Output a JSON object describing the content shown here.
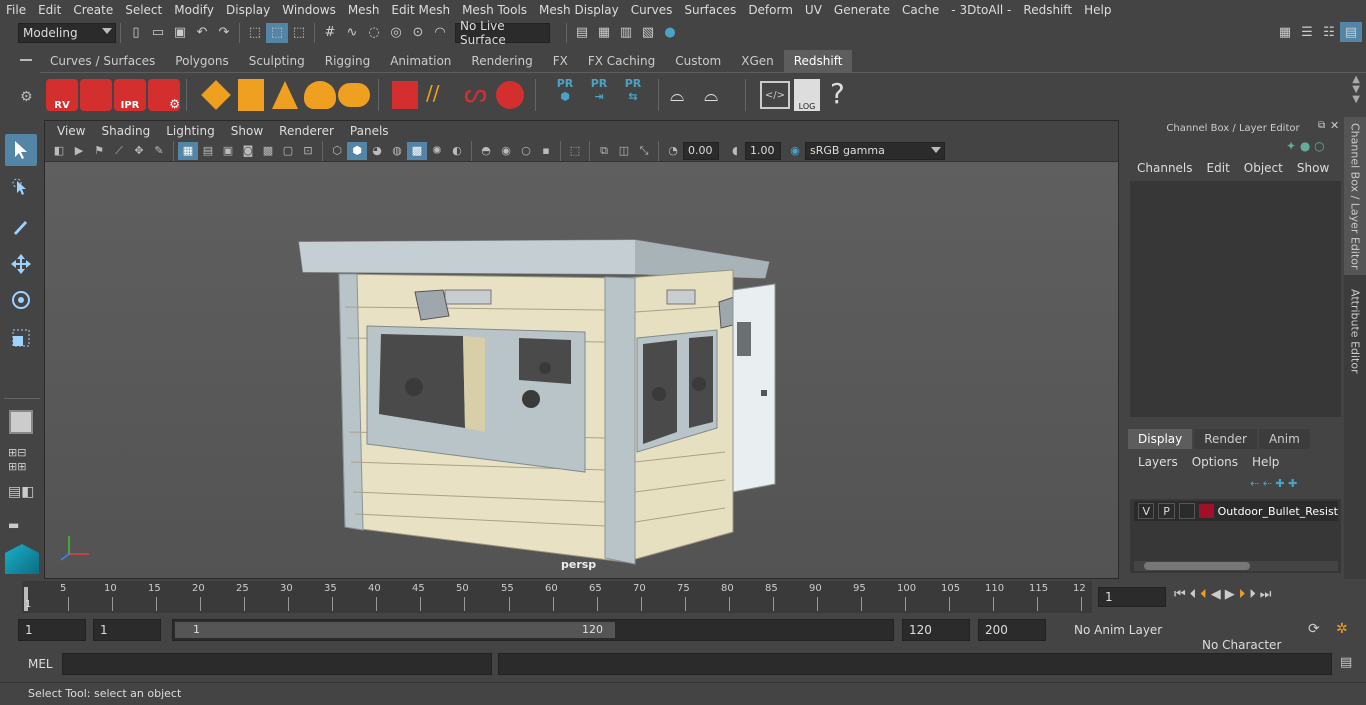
{
  "menubar": [
    "File",
    "Edit",
    "Create",
    "Select",
    "Modify",
    "Display",
    "Windows",
    "Mesh",
    "Edit Mesh",
    "Mesh Tools",
    "Mesh Display",
    "Curves",
    "Surfaces",
    "Deform",
    "UV",
    "Generate",
    "Cache",
    "- 3DtoAll -",
    "Redshift",
    "Help"
  ],
  "status": {
    "workspace": "Modeling",
    "live_surface": "No Live Surface"
  },
  "shelf_tabs": [
    "Curves / Surfaces",
    "Polygons",
    "Sculpting",
    "Rigging",
    "Animation",
    "Rendering",
    "FX",
    "FX Caching",
    "Custom",
    "XGen",
    "Redshift"
  ],
  "shelf_active": "Redshift",
  "shelf_icons": {
    "rv": "RV",
    "ipr": "IPR",
    "pr": "PR",
    "log": "LOG",
    "help": "?"
  },
  "viewport": {
    "menu": [
      "View",
      "Shading",
      "Lighting",
      "Show",
      "Renderer",
      "Panels"
    ],
    "exposure": "0.00",
    "gamma": "1.00",
    "colorspace": "sRGB gamma",
    "camera_label": "persp"
  },
  "channel_box": {
    "title": "Channel Box / Layer Editor",
    "menu": [
      "Channels",
      "Edit",
      "Object",
      "Show"
    ]
  },
  "layer_editor": {
    "tabs": [
      "Display",
      "Render",
      "Anim"
    ],
    "active_tab": "Display",
    "menu": [
      "Layers",
      "Options",
      "Help"
    ],
    "layer": {
      "v": "V",
      "p": "P",
      "name": "Outdoor_Bullet_Resist",
      "color": "#a0102a"
    }
  },
  "side_tabs": [
    "Channel Box / Layer Editor",
    "Attribute Editor"
  ],
  "timeline": {
    "ticks": [
      "5",
      "10",
      "15",
      "20",
      "25",
      "30",
      "35",
      "40",
      "45",
      "50",
      "55",
      "60",
      "65",
      "70",
      "75",
      "80",
      "85",
      "90",
      "95",
      "100",
      "105",
      "110",
      "115",
      "12"
    ],
    "start_marker": "1",
    "current_frame": "1"
  },
  "range": {
    "start": "1",
    "start2": "1",
    "slider_min": "1",
    "slider_max": "120",
    "end": "120",
    "end2": "200",
    "anim_layer": "No Anim Layer",
    "character_set": "No Character Set"
  },
  "cmd": {
    "label": "MEL"
  },
  "help_text": "Select Tool: select an object",
  "colors": {
    "accent": "#5285a6",
    "redshift_red": "#d32f2f",
    "wall": "#e8e1c4",
    "trim": "#b9c4c9"
  }
}
